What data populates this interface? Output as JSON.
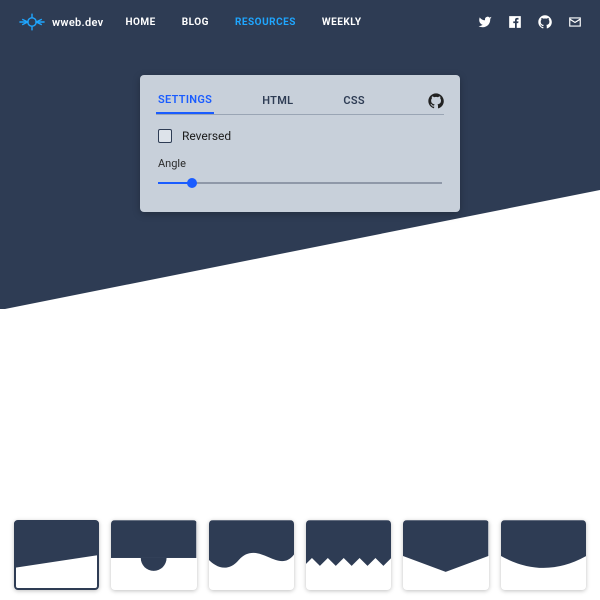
{
  "brand": "wweb.dev",
  "colors": {
    "bg": "#2e3c54",
    "accent": "#1fa6ff",
    "primary": "#1a5cff"
  },
  "nav": [
    {
      "label": "HOME",
      "active": false
    },
    {
      "label": "BLOG",
      "active": false
    },
    {
      "label": "RESOURCES",
      "active": true
    },
    {
      "label": "WEEKLY",
      "active": false
    }
  ],
  "social": [
    "twitter",
    "facebook",
    "github",
    "email"
  ],
  "panel": {
    "tabs": [
      {
        "label": "SETTINGS",
        "active": true
      },
      {
        "label": "HTML",
        "active": false
      },
      {
        "label": "CSS",
        "active": false
      }
    ],
    "reversed_label": "Reversed",
    "reversed_checked": false,
    "angle_label": "Angle",
    "angle_percent": 12
  },
  "shapes": [
    {
      "name": "diagonal",
      "selected": true
    },
    {
      "name": "semicircle",
      "selected": false
    },
    {
      "name": "wave",
      "selected": false
    },
    {
      "name": "zigzag",
      "selected": false
    },
    {
      "name": "triangle",
      "selected": false
    },
    {
      "name": "curve",
      "selected": false
    }
  ]
}
